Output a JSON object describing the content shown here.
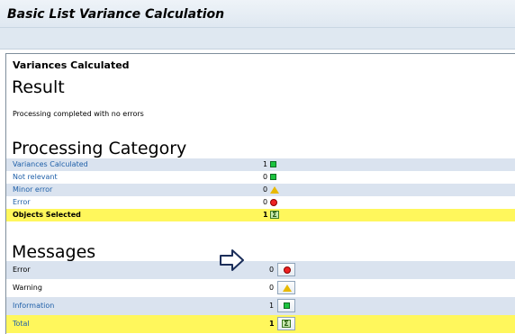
{
  "window": {
    "title": "Basic List Variance Calculation"
  },
  "page": {
    "subtitle": "Variances Calculated",
    "result_heading": "Result",
    "status_message": "Processing completed with no errors",
    "processing_heading": "Processing Category",
    "messages_heading": "Messages"
  },
  "processing_category": [
    {
      "label": "Variances Calculated",
      "count": "1",
      "icon": "green-square-icon"
    },
    {
      "label": "Not relevant",
      "count": "0",
      "icon": "green-square-icon"
    },
    {
      "label": "Minor error",
      "count": "0",
      "icon": "yellow-triangle-icon"
    },
    {
      "label": "Error",
      "count": "0",
      "icon": "red-x-circle-icon"
    },
    {
      "label": "Objects Selected",
      "count": "1",
      "icon": "sum-icon"
    }
  ],
  "messages": [
    {
      "label": "Error",
      "count": "0",
      "icon": "red-circle-icon"
    },
    {
      "label": "Warning",
      "count": "0",
      "icon": "yellow-triangle-icon"
    },
    {
      "label": "Information",
      "count": "1",
      "icon": "green-square-icon"
    },
    {
      "label": "Total",
      "count": "1",
      "icon": "sum-icon"
    }
  ],
  "colors": {
    "row_alt": "#dae3ef",
    "total_row": "#fff75c",
    "link_blue": "#1e5fa8"
  }
}
